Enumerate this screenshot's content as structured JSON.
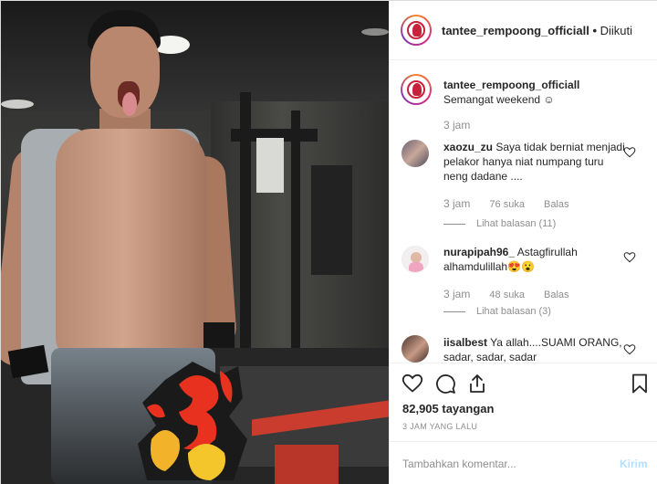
{
  "post": {
    "account": "tantee_rempoong_officiall",
    "separator": "•",
    "follow_status": "Diikuti",
    "caption": "Semangat weekend ☺",
    "caption_time": "3 jam"
  },
  "comments": [
    {
      "user": "xaozu_zu",
      "text": "Saya tidak berniat menjadi pelakor hanya niat numpang turu neng dadane ....",
      "time": "3 jam",
      "likes": "76 suka",
      "reply_label": "Balas",
      "view_replies": "Lihat balasan (11)"
    },
    {
      "user": "nurapipah96_",
      "text": "Astagfirullah alhamdulillah😍😮",
      "time": "3 jam",
      "likes": "48 suka",
      "reply_label": "Balas",
      "view_replies": "Lihat balasan (3)"
    },
    {
      "user": "iisalbest",
      "text": "Ya allah....SUAMI ORANG, sadar, sadar, sadar"
    }
  ],
  "stats": {
    "views": "82,905 tayangan",
    "posted": "3 JAM YANG LALU"
  },
  "composer": {
    "placeholder": "Tambahkan komentar...",
    "send_label": "Kirim"
  },
  "colors": {
    "accent_blue_disabled": "#b2dffc",
    "muted_text": "#8e8e8e",
    "brand_red": "#c7223b"
  },
  "icons": {
    "like": "heart-icon",
    "comment": "comment-icon",
    "share": "share-icon",
    "save": "bookmark-icon"
  }
}
